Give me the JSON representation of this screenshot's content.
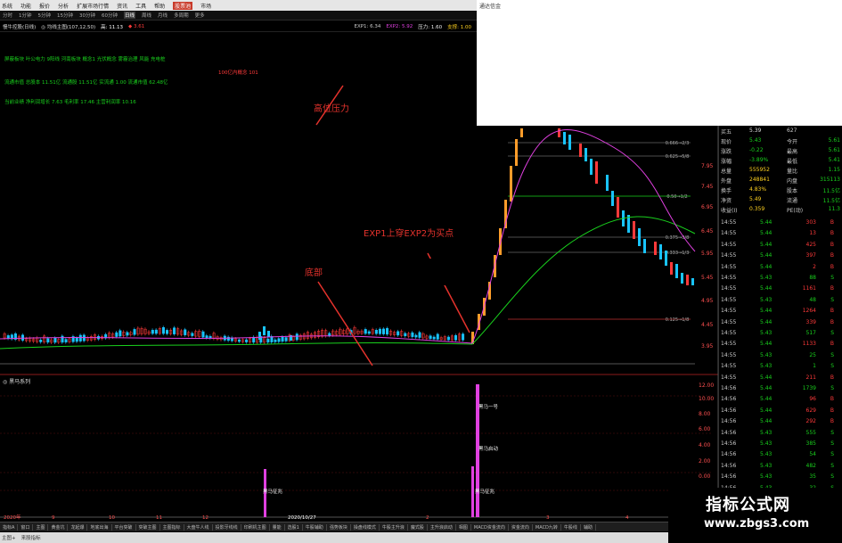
{
  "menu": {
    "items": [
      "系统",
      "功能",
      "报价",
      "分析",
      "扩展市场行情",
      "资讯",
      "工具",
      "帮助",
      "股票池",
      "市场"
    ],
    "app_name": "通达信金"
  },
  "periods": [
    "分时",
    "1分钟",
    "5分钟",
    "15分钟",
    "30分钟",
    "60分钟",
    "日线",
    "周线",
    "月线",
    "多周期",
    "更多"
  ],
  "info": {
    "stock": "慢牛控股(日线)",
    "formula": "◎ 均线主图(107,12,50)",
    "xian": "高: 11.13",
    "ma": "◆ 3.61",
    "exp1": "EXP1: 6.34",
    "exp2": "EXP2: 5.92",
    "pressure": "压力: 1.60",
    "support": "支撑: 1.00"
  },
  "signals": {
    "line1": "屏蔽板块  叶公电力  9阳线  河南板块  概念1 光伏概念  雾霾治理  风能  充电桩",
    "line2": "流通市值  总股本  11.51亿  流通股  11.51亿  实流通  1.00  流通市值  62.48亿",
    "line3": "当前业绩  净利润增长  7.63  毛利率  17.46  主营利润率  10.16",
    "red_note": "100亿内概念  101"
  },
  "annotations": {
    "high": "高位压力",
    "buy": "EXP1上穿EXP2为买点",
    "bottom": "底部",
    "dragon1": "黑马一号",
    "dragon_start": "黑马启动",
    "dragon_sign1": "黑马征兆",
    "dragon_sign2": "黑马征兆"
  },
  "sub_title": "◎ 黑马系列",
  "price_axis": [
    "7.95",
    "7.45",
    "6.95",
    "6.45",
    "5.95",
    "5.45",
    "4.95",
    "4.45",
    "3.95"
  ],
  "sub_axis": [
    "12.00",
    "10.00",
    "8.00",
    "6.00",
    "4.00",
    "2.00",
    "0.00"
  ],
  "fib": [
    "0.666→2/3",
    "0.625→5/8",
    "0.50→1/2",
    "0.375→3/8",
    "0.333→1/3",
    "0.125→1/8"
  ],
  "quote": {
    "rows": [
      {
        "l": "买五",
        "v": "5.39",
        "r": "627"
      },
      {
        "l": "现价",
        "v": "5.43",
        "r": "今开",
        "r2": "5.61"
      },
      {
        "l": "涨跌",
        "v": "-0.22",
        "r": "最高",
        "r2": "5.61"
      },
      {
        "l": "涨幅",
        "v": "-3.89%",
        "r": "最低",
        "r2": "5.41"
      },
      {
        "l": "总量",
        "v": "555952",
        "r": "量比",
        "r2": "1.15"
      },
      {
        "l": "外盘",
        "v": "248841",
        "r": "内盘",
        "r2": "315113"
      },
      {
        "l": "换手",
        "v": "4.83%",
        "r": "股本",
        "r2": "11.5亿"
      },
      {
        "l": "净资",
        "v": "5.49",
        "r": "流通",
        "r2": "11.5亿"
      },
      {
        "l": "收益(I)",
        "v": "0.359",
        "r": "PE(动)",
        "r2": "11.3"
      }
    ],
    "ticks": [
      {
        "t": "14:55",
        "p": "5.44",
        "v": "303",
        "s": "B"
      },
      {
        "t": "14:55",
        "p": "5.44",
        "v": "13",
        "s": "B"
      },
      {
        "t": "14:55",
        "p": "5.44",
        "v": "425",
        "s": "B"
      },
      {
        "t": "14:55",
        "p": "5.44",
        "v": "397",
        "s": "B"
      },
      {
        "t": "14:55",
        "p": "5.44",
        "v": "2",
        "s": "B"
      },
      {
        "t": "14:55",
        "p": "5.43",
        "v": "88",
        "s": "S"
      },
      {
        "t": "14:55",
        "p": "5.44",
        "v": "1161",
        "s": "B"
      },
      {
        "t": "14:55",
        "p": "5.43",
        "v": "48",
        "s": "S"
      },
      {
        "t": "14:55",
        "p": "5.44",
        "v": "1264",
        "s": "B"
      },
      {
        "t": "14:55",
        "p": "5.44",
        "v": "339",
        "s": "B"
      },
      {
        "t": "14:55",
        "p": "5.43",
        "v": "517",
        "s": "S"
      },
      {
        "t": "14:55",
        "p": "5.44",
        "v": "1133",
        "s": "B"
      },
      {
        "t": "14:55",
        "p": "5.43",
        "v": "25",
        "s": "S"
      },
      {
        "t": "14:55",
        "p": "5.43",
        "v": "1",
        "s": "S"
      },
      {
        "t": "14:55",
        "p": "5.44",
        "v": "211",
        "s": "B"
      },
      {
        "t": "14:56",
        "p": "5.44",
        "v": "1739",
        "s": "S"
      },
      {
        "t": "14:56",
        "p": "5.44",
        "v": "96",
        "s": "B"
      },
      {
        "t": "14:56",
        "p": "5.44",
        "v": "629",
        "s": "B"
      },
      {
        "t": "14:56",
        "p": "5.44",
        "v": "292",
        "s": "B"
      },
      {
        "t": "14:56",
        "p": "5.43",
        "v": "555",
        "s": "S"
      },
      {
        "t": "14:56",
        "p": "5.43",
        "v": "385",
        "s": "S"
      },
      {
        "t": "14:56",
        "p": "5.43",
        "v": "54",
        "s": "S"
      },
      {
        "t": "14:56",
        "p": "5.43",
        "v": "482",
        "s": "S"
      },
      {
        "t": "14:56",
        "p": "5.43",
        "v": "35",
        "s": "S"
      },
      {
        "t": "14:56",
        "p": "5.43",
        "v": "32",
        "s": "S"
      }
    ]
  },
  "date_axis": [
    "2020年",
    "9",
    "10",
    "11",
    "12",
    "2020/10/27",
    "2",
    "3",
    "4"
  ],
  "tabs": [
    "指标A",
    "窗口",
    "主图",
    "黄金坑",
    "龙起爆",
    "地底出海",
    "平台突破",
    "突破主图",
    "主图指标",
    "大盘牛人线",
    "投影牙线线",
    "印刷机主图",
    "量能",
    "选股1",
    "牛股辅助",
    "强势板块",
    "操盘线模式",
    "牛股主升浪",
    "魔式股",
    "主升浪启动",
    "相图",
    "MACD资金流向",
    "资金流向",
    "MACD九转",
    "牛股线",
    "辅助"
  ],
  "status": [
    "主图+",
    "来股指标"
  ],
  "watermark": {
    "title": "指标公式网",
    "url": "www.zbgs3.com"
  },
  "colors": {
    "up": "#ff3a3a",
    "down": "#19c4ff",
    "green": "#19d11d",
    "magenta": "#e040e0",
    "ema_orange": "#ff9d2a"
  }
}
